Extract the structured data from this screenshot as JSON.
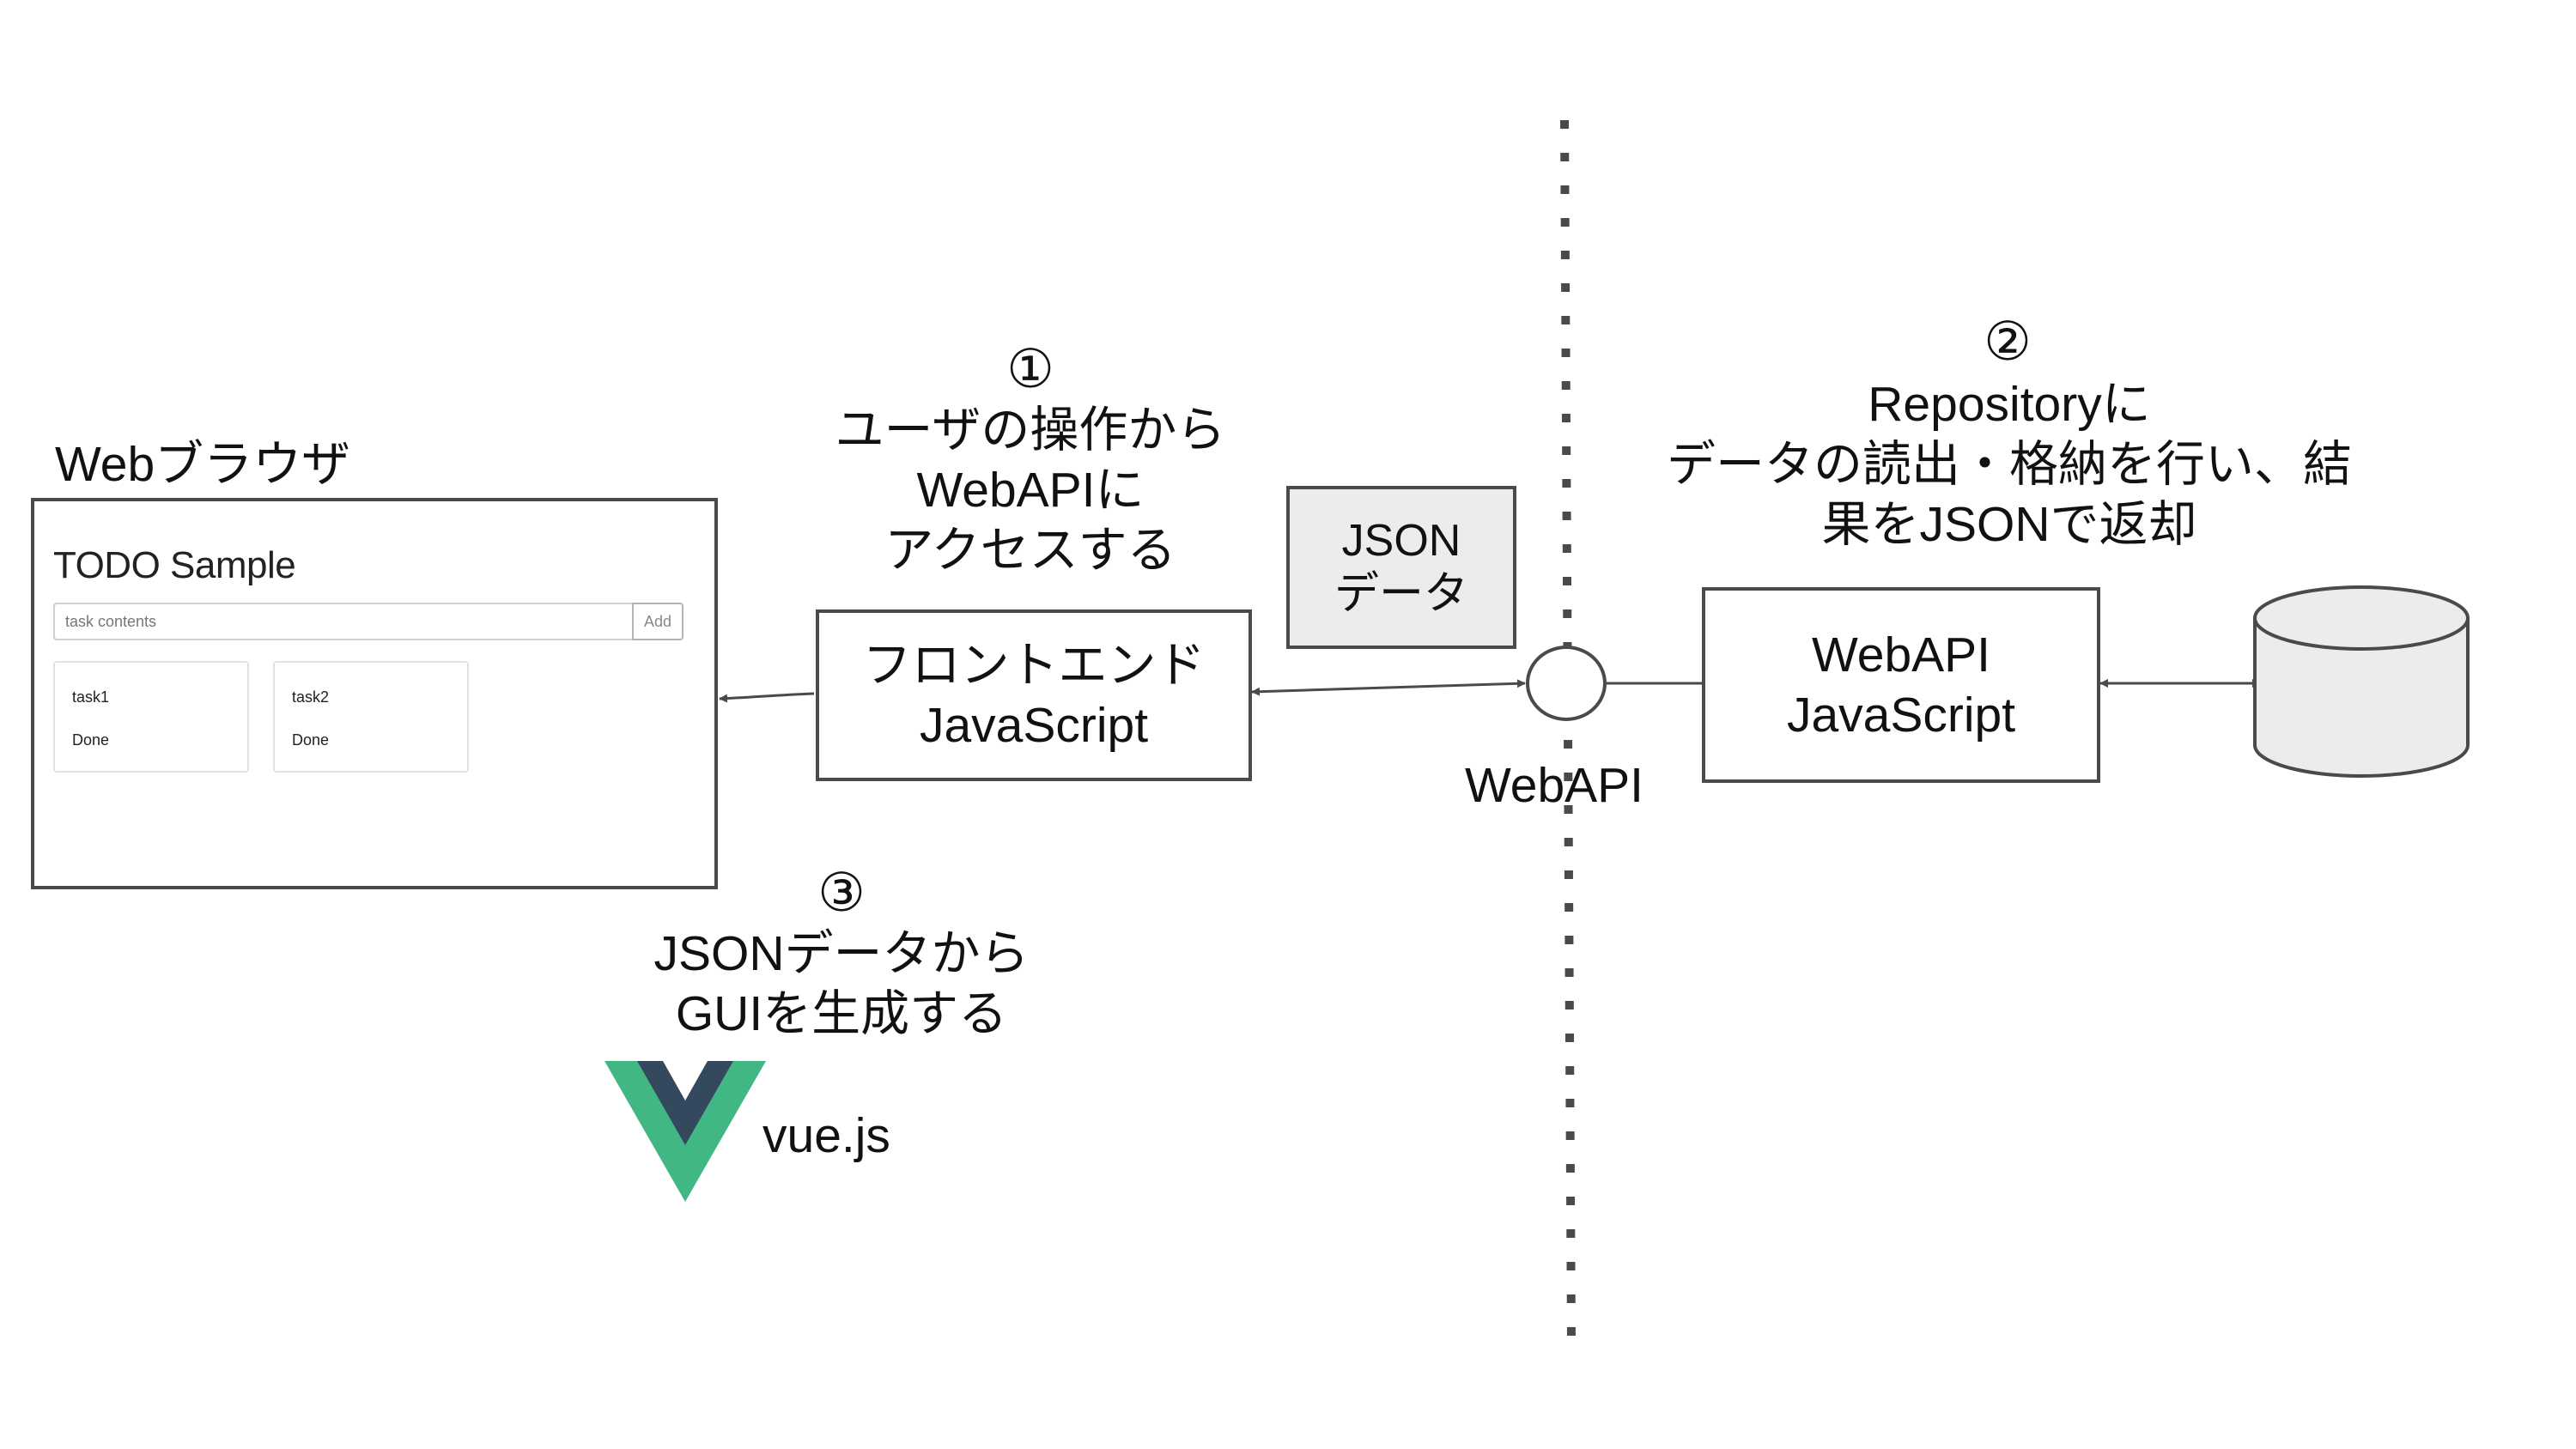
{
  "browser": {
    "label": "Webブラウザ",
    "app_title": "TODO Sample",
    "input_placeholder": "task contents",
    "add_button": "Add",
    "cards": [
      {
        "name": "task1",
        "status": "Done"
      },
      {
        "name": "task2",
        "status": "Done"
      }
    ]
  },
  "step1": {
    "number": "①",
    "lines": [
      "ユーザの操作から",
      "WebAPIに",
      "アクセスする"
    ]
  },
  "frontend_box": {
    "lines": [
      "フロントエンド",
      "JavaScript"
    ]
  },
  "json_box": {
    "lines": [
      "JSON",
      "データ"
    ]
  },
  "webapi_label": "WebAPI",
  "step2": {
    "number": "②",
    "lines": [
      "Repositoryに",
      "データの読出・格納を行い、結",
      "果をJSONで返却"
    ]
  },
  "webapi_box": {
    "lines": [
      "WebAPI",
      "JavaScript"
    ]
  },
  "step3": {
    "number": "③",
    "lines": [
      "JSONデータから",
      "GUIを生成する"
    ]
  },
  "vue_label": "vue.js",
  "colors": {
    "line": "#4a4a4a",
    "vue_green": "#41b883",
    "vue_dark": "#35495e",
    "json_fill": "#ececec",
    "cylinder_fill": "#ececec"
  }
}
